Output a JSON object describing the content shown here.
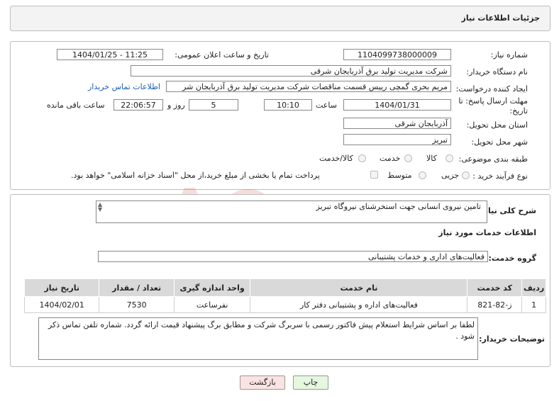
{
  "header": {
    "title": "جزئیات اطلاعات نیاز"
  },
  "fields": {
    "need_number_label": "شماره نیاز:",
    "need_number": "1104099738000009",
    "announce_label": "تاریخ و ساعت اعلان عمومی:",
    "announce_value": "1404/01/25 - 11:25",
    "buyer_label": "نام دستگاه خریدار:",
    "buyer_value": "شرکت مدیریت تولید برق آذربایجان شرقی",
    "requester_label": "ایجاد کننده درخواست:",
    "requester_value": "مریم بحری گمچی رییس قسمت مناقصات شرکت مدیریت تولید برق آذربایجان شر",
    "contact_link": "اطلاعات تماس خریدار",
    "deadline_label_1": "مهلت ارسال پاسخ: تا",
    "deadline_label_2": "تاریخ:",
    "deadline_date": "1404/01/31",
    "time_label": "ساعت",
    "deadline_time": "10:10",
    "days_value": "5",
    "days_label": "روز و",
    "remaining_time": "22:06:57",
    "remaining_label": "ساعت باقی مانده",
    "province_label": "استان محل تحویل:",
    "province_value": "آذربایجان شرقی",
    "city_label": "شهر محل تحویل:",
    "city_value": "تبریز",
    "category_label": "طبقه بندی موضوعی:",
    "category_options": [
      "کالا",
      "خدمت",
      "کالا/خدمت"
    ],
    "purchase_label": "نوع فرآیند خرید :",
    "purchase_options": [
      "جزیی",
      "متوسط"
    ],
    "payment_note": "پرداخت تمام یا بخشی از مبلغ خرید،از محل \"اسناد خزانه اسلامی\" خواهد بود."
  },
  "description": {
    "general_label": "شرح کلی نیاز:",
    "general_value": "تامین نیروی انسانی جهت  استخرشنای نیروگاه تبریز",
    "services_heading": "اطلاعات خدمات مورد نیاز",
    "group_label": "گروه خدمت:",
    "group_value": "فعالیت‌های اداری و خدمات پشتیبانی"
  },
  "table": {
    "headers": [
      "ردیف",
      "کد خدمت",
      "نام خدمت",
      "واحد اندازه گیری",
      "تعداد / مقدار",
      "تاریخ نیاز"
    ],
    "rows": [
      [
        "1",
        "ز-82-821",
        "فعالیت‌های اداره و پشتیبانی دفتر کار",
        "نفرساعت",
        "7530",
        "1404/02/01"
      ]
    ]
  },
  "buyer_notes": {
    "label": "توضیحات خریدار:",
    "value": "لطفا بر اساس شرایط استعلام پیش فاکتور رسمی با سربرگ شرکت و مطابق برگ  پیشنهاد قیمت  ارائه گردد.  شماره تلفن تماس ذکر شود ."
  },
  "buttons": {
    "print": "چاپ",
    "back": "بازگشت"
  },
  "watermark": {
    "text": "AriaTender.neT"
  },
  "colors": {
    "link": "#1a5fb4",
    "print_bg": "#e6f7df",
    "back_bg": "#fbe3e3",
    "watermark": "#c0392b"
  }
}
